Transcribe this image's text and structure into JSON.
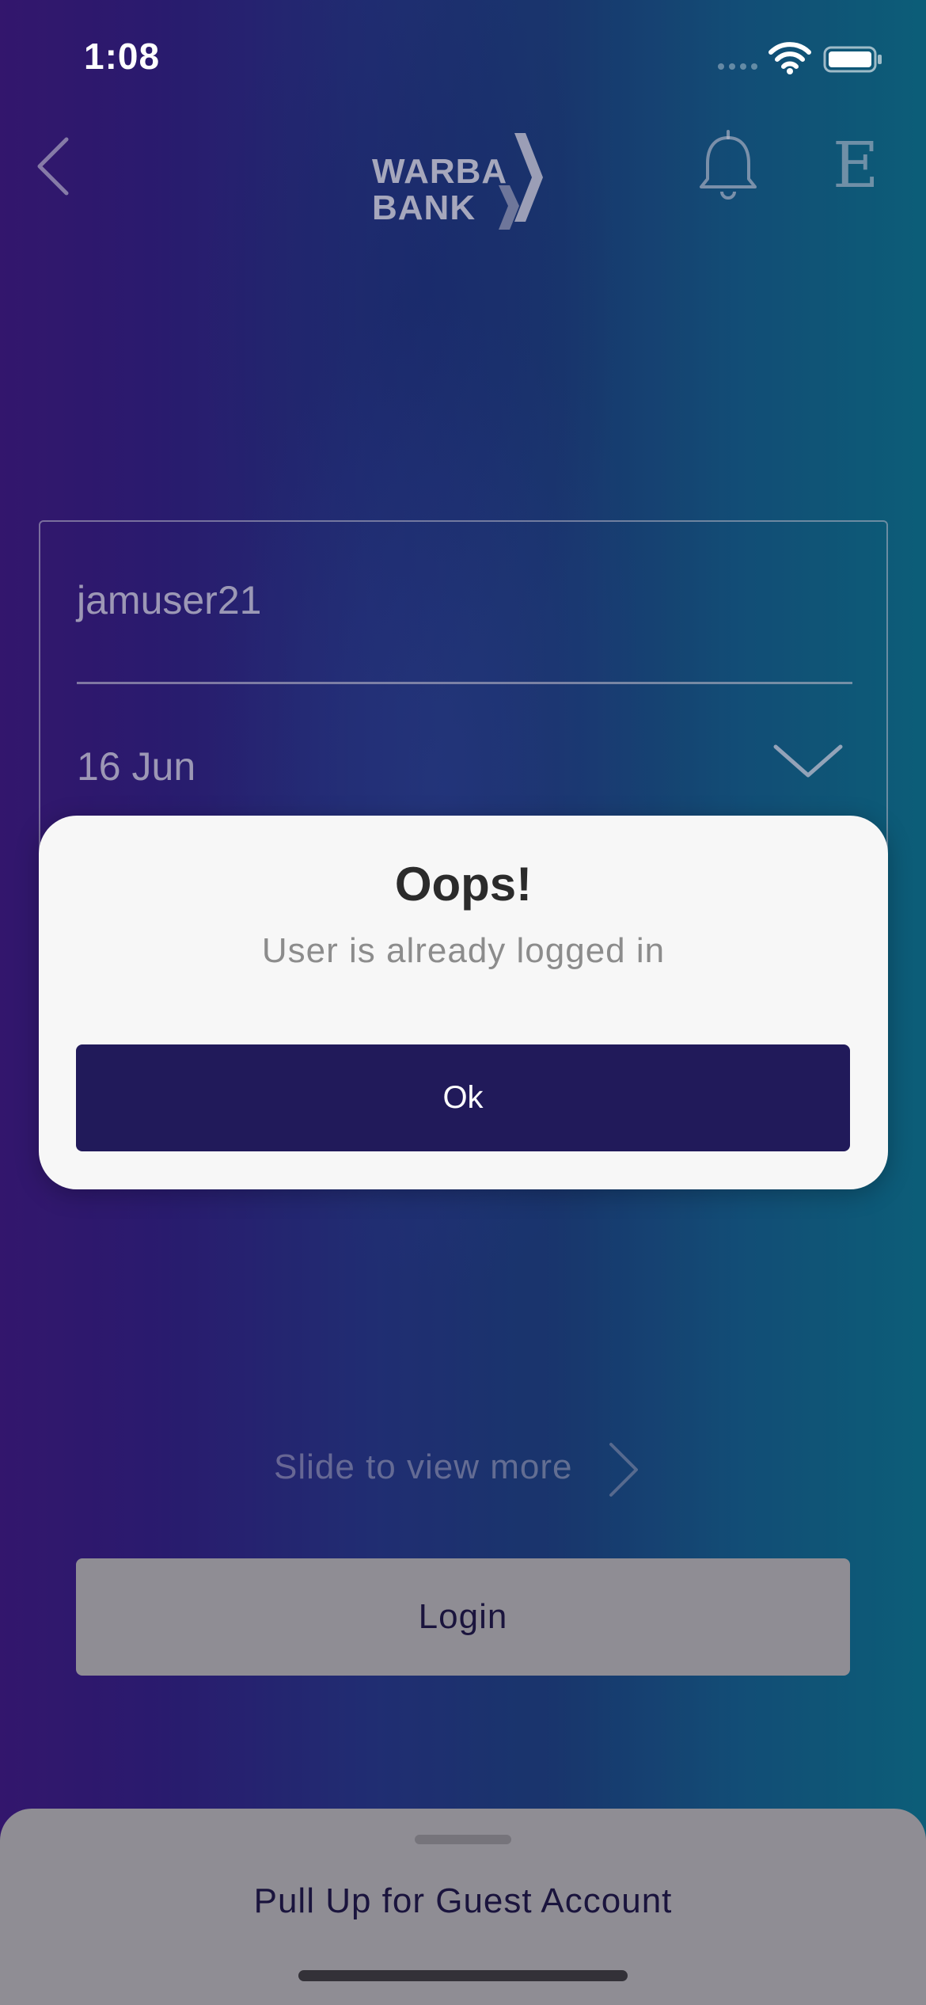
{
  "status_bar": {
    "time": "1:08"
  },
  "header": {
    "logo_line1": "WARBA",
    "logo_line2": "BANK",
    "language_toggle": "E"
  },
  "form": {
    "username_value": "jamuser21",
    "date_value": "16 Jun"
  },
  "alert": {
    "title": "Oops!",
    "message": "User is already logged in",
    "ok_label": "Ok"
  },
  "slide_hint": "Slide to view more",
  "login_label": "Login",
  "guest_sheet_label": "Pull Up for Guest Account",
  "colors": {
    "alert_button": "#211a5a",
    "alert_background": "#f7f7f7",
    "login_button": "#aaaaaa",
    "text_dark": "#1c1640"
  }
}
